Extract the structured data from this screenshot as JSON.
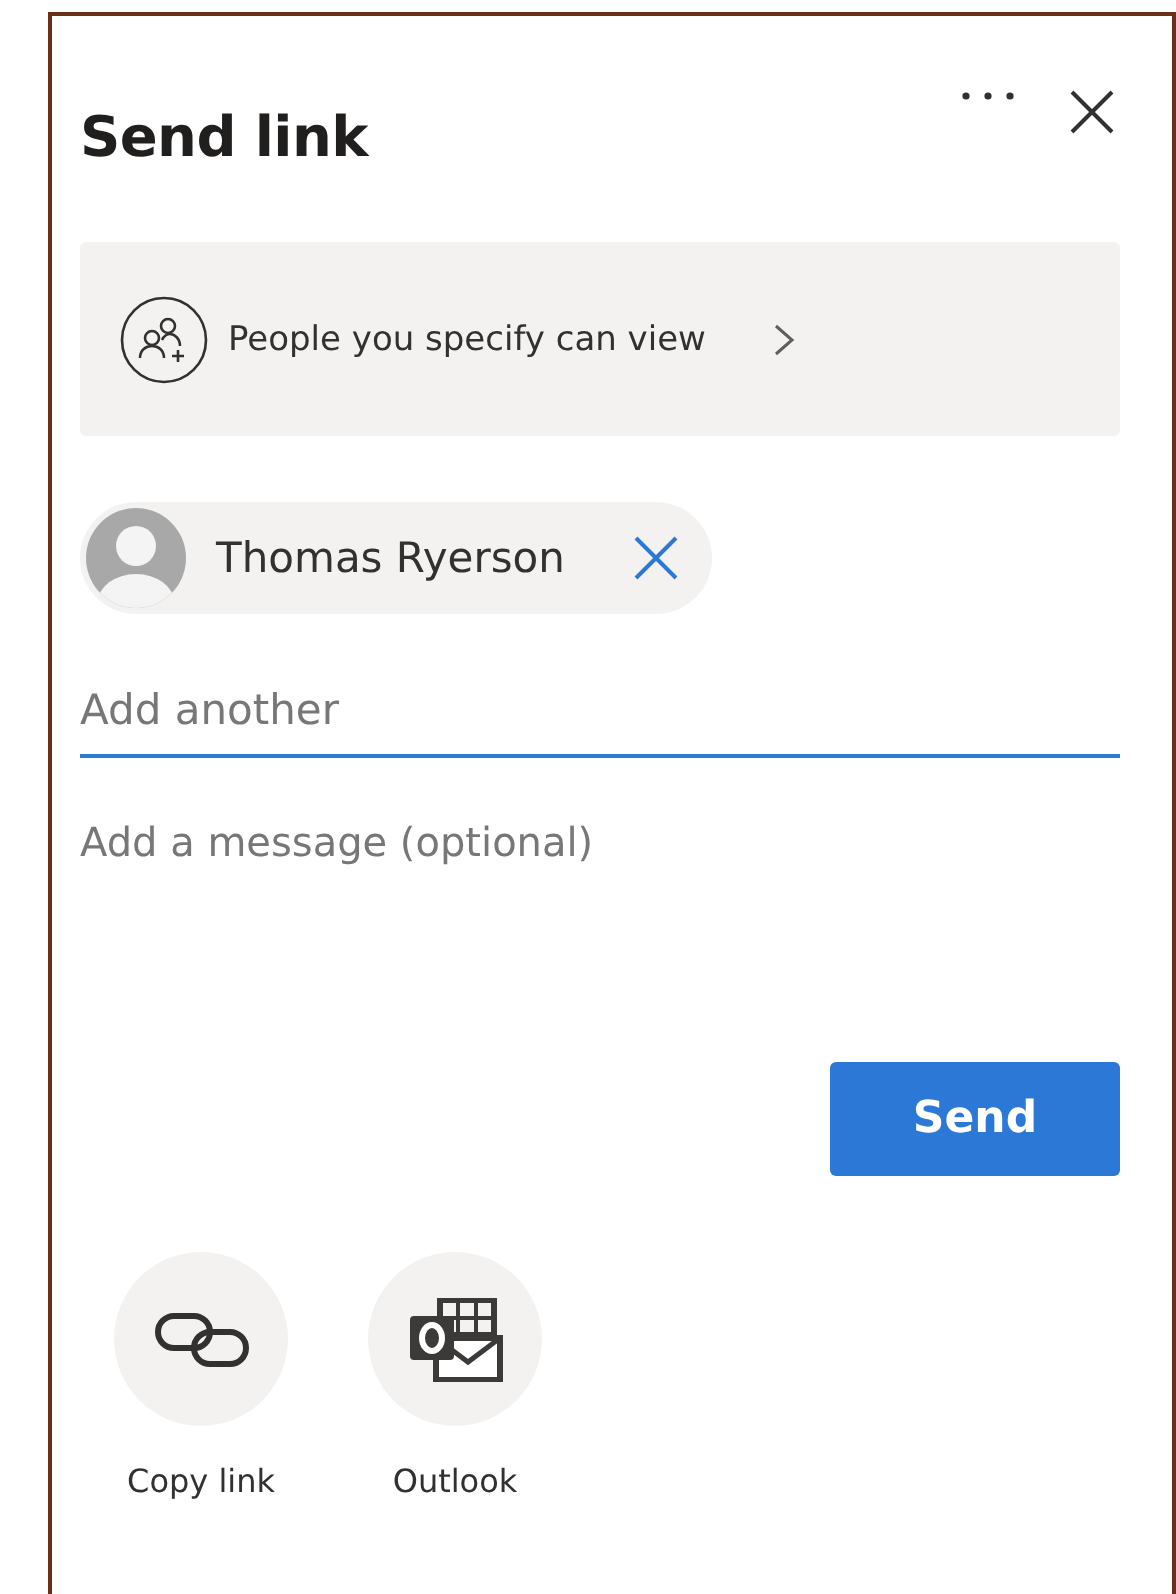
{
  "title": "Send link",
  "permission": {
    "label": "People you specify can view"
  },
  "recipients": [
    {
      "name": "Thomas Ryerson"
    }
  ],
  "recipient_field": {
    "placeholder": "Add another",
    "focused": true
  },
  "message_field": {
    "placeholder": "Add a message (optional)"
  },
  "send_button": {
    "label": "Send"
  },
  "share_options": [
    {
      "kind": "copy",
      "label": "Copy link"
    },
    {
      "kind": "outlook",
      "label": "Outlook"
    }
  ]
}
